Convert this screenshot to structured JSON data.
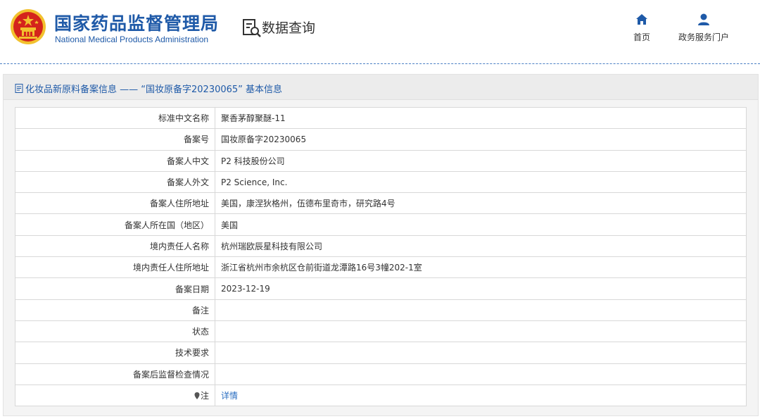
{
  "header": {
    "logo_cn": "国家药品监督管理局",
    "logo_en": "National Medical Products Administration",
    "section_title": "数据查询",
    "nav": [
      {
        "label": "首页",
        "icon": "home-icon"
      },
      {
        "label": "政务服务门户",
        "icon": "user-icon"
      }
    ]
  },
  "panel": {
    "title": "化妆品新原料备案信息 —— “国妆原备字20230065” 基本信息"
  },
  "rows": [
    {
      "label": "标准中文名称",
      "value": "聚香茅醇聚醚-11"
    },
    {
      "label": "备案号",
      "value": "国妆原备字20230065"
    },
    {
      "label": "备案人中文",
      "value": "P2 科技股份公司"
    },
    {
      "label": "备案人外文",
      "value": "P2 Science, Inc."
    },
    {
      "label": "备案人住所地址",
      "value": "美国，康涅狄格州，伍德布里奇市，研究路4号"
    },
    {
      "label": "备案人所在国（地区）",
      "value": "美国"
    },
    {
      "label": "境内责任人名称",
      "value": "杭州瑞欧辰星科技有限公司"
    },
    {
      "label": "境内责任人住所地址",
      "value": "浙江省杭州市余杭区仓前街道龙潭路16号3幢202-1室"
    },
    {
      "label": "备案日期",
      "value": "2023-12-19"
    },
    {
      "label": "备注",
      "value": ""
    },
    {
      "label": "状态",
      "value": ""
    },
    {
      "label": "技术要求",
      "value": ""
    },
    {
      "label": "备案后监督检查情况",
      "value": ""
    },
    {
      "label": "注",
      "value": "详情"
    }
  ],
  "colors": {
    "brand_blue": "#1f5aa8",
    "link_blue": "#2a6ec1",
    "emblem_red": "#d4241c",
    "emblem_gold": "#f2c12e"
  }
}
